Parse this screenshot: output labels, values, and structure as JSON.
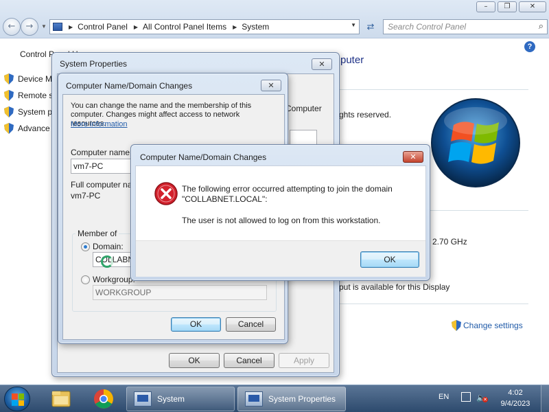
{
  "explorer": {
    "breadcrumb": [
      "Control Panel",
      "All Control Panel Items",
      "System"
    ],
    "search_placeholder": "Search Control Panel",
    "left_pane": {
      "home_link": "Control Panel Ho",
      "tasks": [
        {
          "label": "Device M",
          "icon": "shield-icon"
        },
        {
          "label": "Remote s",
          "icon": "shield-icon"
        },
        {
          "label": "System p",
          "icon": "shield-icon"
        },
        {
          "label": "Advance",
          "icon": "shield-icon"
        }
      ]
    },
    "main": {
      "heading_fragment": "puter",
      "copyright_fragment": "ghts reserved.",
      "cpu_fragment": "2.70 GHz",
      "pen_fragment": "put is available for this Display",
      "computer_fragment": "Computer",
      "change_settings": "Change settings"
    }
  },
  "system_properties": {
    "title": "System Properties",
    "ok": "OK",
    "cancel": "Cancel",
    "apply": "Apply",
    "behind_fragment": "ges"
  },
  "name_changes": {
    "title": "Computer Name/Domain Changes",
    "description": "You can change the name and the membership of this computer. Changes might affect access to network resources.",
    "more_info": "More information",
    "computer_name_label": "Computer name:",
    "computer_name_value": "vm7-PC",
    "full_name_label": "Full computer name",
    "full_name_value": "vm7-PC",
    "member_of": "Member of",
    "domain_label": "Domain:",
    "domain_value": "COLLABNE",
    "workgroup_label": "Workgroup:",
    "workgroup_value": "WORKGROUP",
    "ok": "OK",
    "cancel": "Cancel"
  },
  "error_dialog": {
    "title": "Computer Name/Domain Changes",
    "message_line1": "The following error occurred attempting to join the domain",
    "message_line2": "\"COLLABNET.LOCAL\":",
    "detail": "The user is not allowed to log on from this workstation.",
    "ok": "OK",
    "icon": "error-icon"
  },
  "taskbar": {
    "pinned": [
      "file-explorer-icon",
      "chrome-icon"
    ],
    "tasks": [
      {
        "label": "System"
      },
      {
        "label": "System Properties"
      }
    ],
    "language": "EN",
    "time": "4:02",
    "date": "9/4/2023"
  },
  "colors": {
    "link": "#1f5aa8",
    "heading": "#1e3287",
    "error_red": "#d3212c"
  }
}
